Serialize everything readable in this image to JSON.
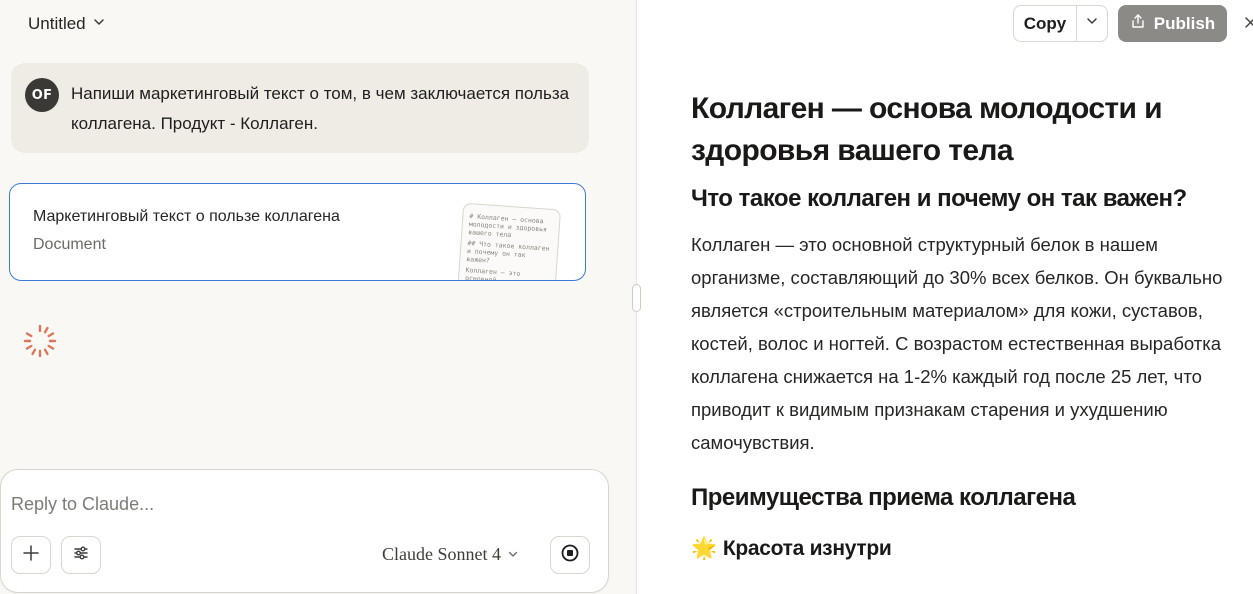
{
  "chat": {
    "title": "Untitled",
    "user_message": {
      "avatar_initials": "OF",
      "text": "Напиши маркетинговый текст о том, в чем заключается польза коллагена. Продукт - Коллаген."
    },
    "artifact": {
      "title": "Маркетинговый текст о пользе коллагена",
      "type": "Document",
      "thumbnail_lines": [
        "# Коллаген — основа молодости и здоровья вашего тела",
        "## Что такое коллаген и почему он так важен?",
        "Коллаген — это основной"
      ]
    },
    "composer": {
      "placeholder": "Reply to Claude...",
      "model": "Claude Sonnet 4"
    }
  },
  "toolbar": {
    "copy_label": "Copy",
    "publish_label": "Publish"
  },
  "document": {
    "h1": "Коллаген — основа молодости и здоровья вашего тела",
    "section1_heading": "Что такое коллаген и почему он так важен?",
    "section1_paragraph": "Коллаген — это основной структурный белок в нашем организме, составляющий до 30% всех белков. Он буквально является «строительным материалом» для кожи, суставов, костей, волос и ногтей. С возрастом естественная выработка коллагена снижается на 1-2% каждый год после 25 лет, что приводит к видимым признакам старения и ухудшению самочувствия.",
    "section2_heading": "Преимущества приема коллагена",
    "subsection1_emoji": "🌟",
    "subsection1_heading": "Красота изнутри"
  },
  "colors": {
    "accent_border": "#3a7bd5",
    "spinner": "#d97757",
    "publish_bg": "#8b8a86"
  }
}
